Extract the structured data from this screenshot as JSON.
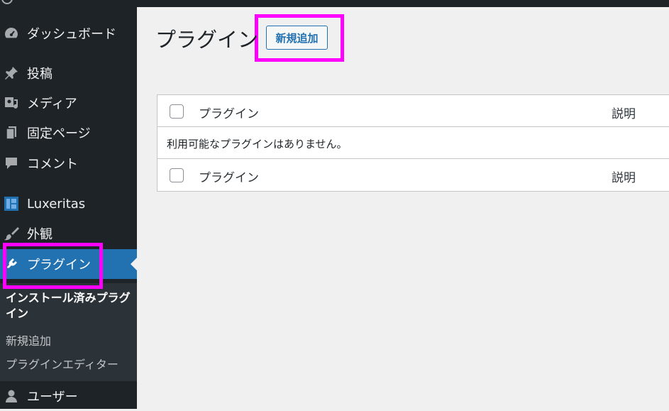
{
  "sidebar": {
    "items": [
      {
        "label": "ダッシュボード",
        "icon": "dashboard-icon"
      },
      {
        "label": "投稿",
        "icon": "pin-icon"
      },
      {
        "label": "メディア",
        "icon": "media-icon"
      },
      {
        "label": "固定ページ",
        "icon": "page-icon"
      },
      {
        "label": "コメント",
        "icon": "comment-icon"
      },
      {
        "label": "Luxeritas",
        "icon": "luxeritas-icon"
      },
      {
        "label": "外観",
        "icon": "brush-icon"
      },
      {
        "label": "プラグイン",
        "icon": "plugin-icon"
      },
      {
        "label": "ユーザー",
        "icon": "user-icon"
      }
    ],
    "submenu": [
      {
        "label": "インストール済みプラグイン"
      },
      {
        "label": "新規追加"
      },
      {
        "label": "プラグインエディター"
      }
    ]
  },
  "main": {
    "title": "プラグイン",
    "add_new_label": "新規追加",
    "table": {
      "col_name": "プラグイン",
      "col_desc": "説明",
      "empty_message": "利用可能なプラグインはありません。"
    }
  },
  "colors": {
    "sidebar_bg": "#1d2327",
    "current_bg": "#2271b1",
    "highlight": "#ff00ff"
  }
}
